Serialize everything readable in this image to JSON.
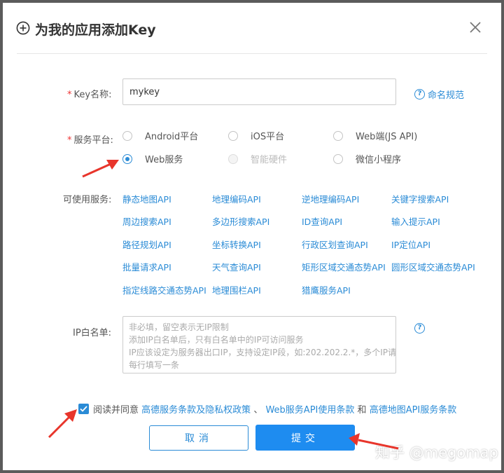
{
  "dialog": {
    "title": "为我的应用添加Key"
  },
  "key_field": {
    "label": "Key名称:",
    "value": "mykey",
    "help": "命名规范"
  },
  "platform": {
    "label": "服务平台:",
    "options": [
      {
        "label": "Android平台",
        "checked": false,
        "disabled": false
      },
      {
        "label": "iOS平台",
        "checked": false,
        "disabled": false
      },
      {
        "label": "Web端(JS API)",
        "checked": false,
        "disabled": false
      },
      {
        "label": "Web服务",
        "checked": true,
        "disabled": false
      },
      {
        "label": "智能硬件",
        "checked": false,
        "disabled": true
      },
      {
        "label": "微信小程序",
        "checked": false,
        "disabled": false
      }
    ]
  },
  "services": {
    "label": "可使用服务:",
    "items": [
      "静态地图API",
      "地理编码API",
      "逆地理编码API",
      "关键字搜索API",
      "周边搜索API",
      "多边形搜索API",
      "ID查询API",
      "输入提示API",
      "路径规划API",
      "坐标转换API",
      "行政区划查询API",
      "IP定位API",
      "批量请求API",
      "天气查询API",
      "矩形区域交通态势API",
      "圆形区域交通态势API",
      "指定线路交通态势API",
      "地理围栏API",
      "猎鹰服务API"
    ]
  },
  "ip_whitelist": {
    "label": "IP白名单:",
    "placeholder_lines": [
      "非必填，留空表示无IP限制",
      "添加IP白名单后，只有白名单中的IP可访问服务",
      "IP应该设定为服务器出口IP，支持设定IP段，如:202.202.2.*，多个IP请",
      "每行填写一条"
    ]
  },
  "agreement": {
    "checked": true,
    "prefix": "阅读并同意",
    "link1": "高德服务条款及隐私权政策",
    "sep1": "、",
    "link2": "Web服务API使用条款",
    "sep2": "和",
    "link3": "高德地图API服务条款"
  },
  "buttons": {
    "cancel": "取消",
    "submit": "提交"
  },
  "watermark": "知乎 @megomap",
  "colors": {
    "accent": "#2a8bd6",
    "primary_button": "#1e8cf0",
    "required": "#e33333",
    "annotation_arrow": "#e8352b"
  }
}
